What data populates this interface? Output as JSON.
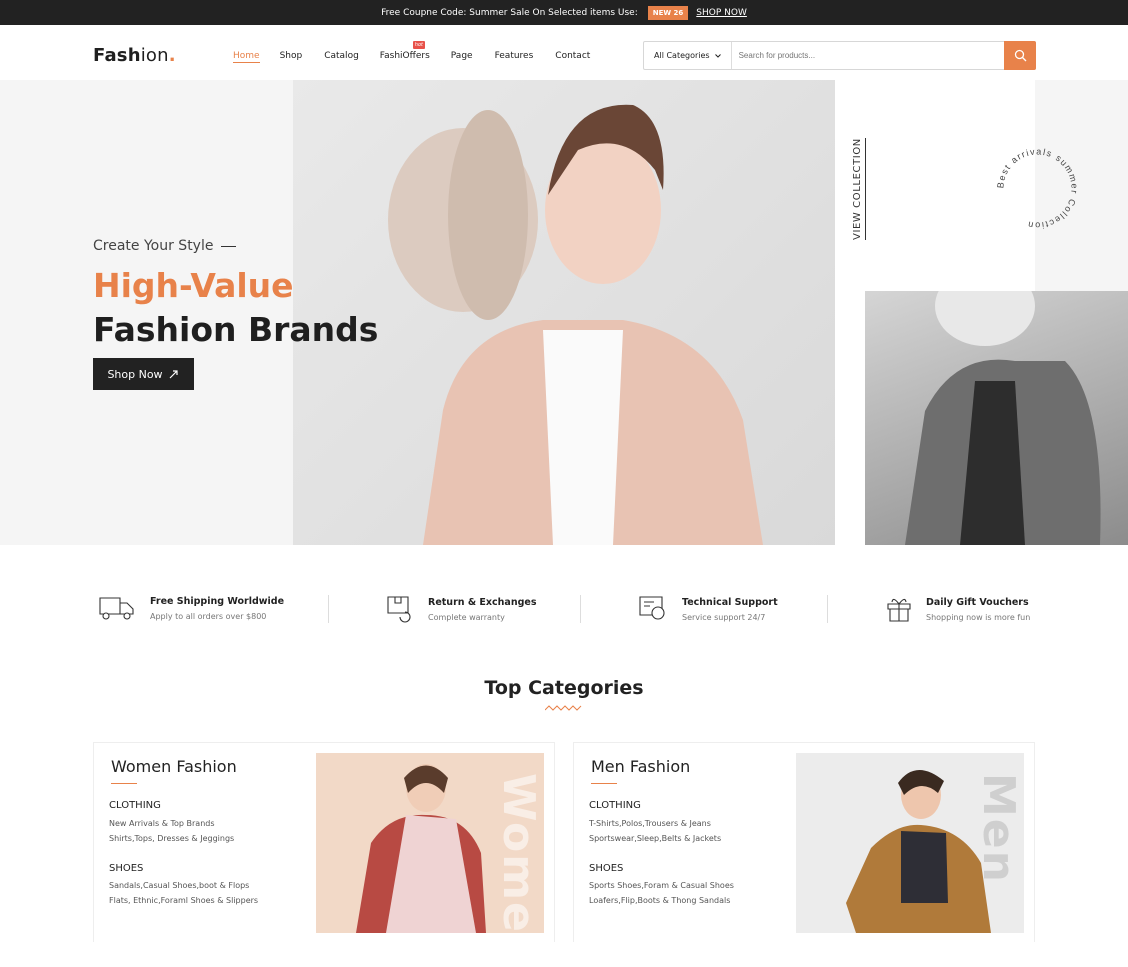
{
  "topbar": {
    "message": "Free Coupne Code: Summer Sale On Selected items Use:",
    "badge": "NEW 26",
    "link": "SHOP NOW"
  },
  "logo": {
    "text1": "Fash",
    "text2": "ion",
    "dot": "."
  },
  "nav": {
    "items": [
      "Home",
      "Shop",
      "Catalog",
      "FashiOffers",
      "Page",
      "Features",
      "Contact"
    ],
    "hot": "hot"
  },
  "search": {
    "category": "All Categories",
    "placeholder": "Search for products..."
  },
  "hero": {
    "tagline": "Create Your Style",
    "title1": "High-Value",
    "title2": "Fashion Brands",
    "button": "Shop Now",
    "view": "VIEW COLLECTION",
    "circle_text": "Best arrivals summer Collection"
  },
  "features": [
    {
      "title": "Free Shipping Worldwide",
      "sub": "Apply to all orders over $800"
    },
    {
      "title": "Return & Exchanges",
      "sub": "Complete warranty"
    },
    {
      "title": "Technical Support",
      "sub": "Service support 24/7"
    },
    {
      "title": "Daily Gift Vouchers",
      "sub": "Shopping now is more fun"
    }
  ],
  "section": {
    "title": "Top Categories"
  },
  "women": {
    "title": "Women Fashion",
    "clothing": "CLOTHING",
    "c1": "New Arrivals & Top Brands",
    "c2": "Shirts,Tops, Dresses & Jeggings",
    "shoes": "SHOES",
    "s1": "Sandals,Casual Shoes,boot & Flops",
    "s2": "Flats, Ethnic,Foraml Shoes & Slippers",
    "watermark": "Women"
  },
  "men": {
    "title": "Men Fashion",
    "clothing": "CLOTHING",
    "c1": "T-Shirts,Polos,Trousers & Jeans",
    "c2": "Sportswear,Sleep,Belts & Jackets",
    "shoes": "SHOES",
    "s1": "Sports Shoes,Foram & Casual Shoes",
    "s2": "Loafers,Flip,Boots & Thong Sandals",
    "watermark": "Men"
  },
  "colors": {
    "accent": "#e8824a",
    "dark": "#222222"
  }
}
